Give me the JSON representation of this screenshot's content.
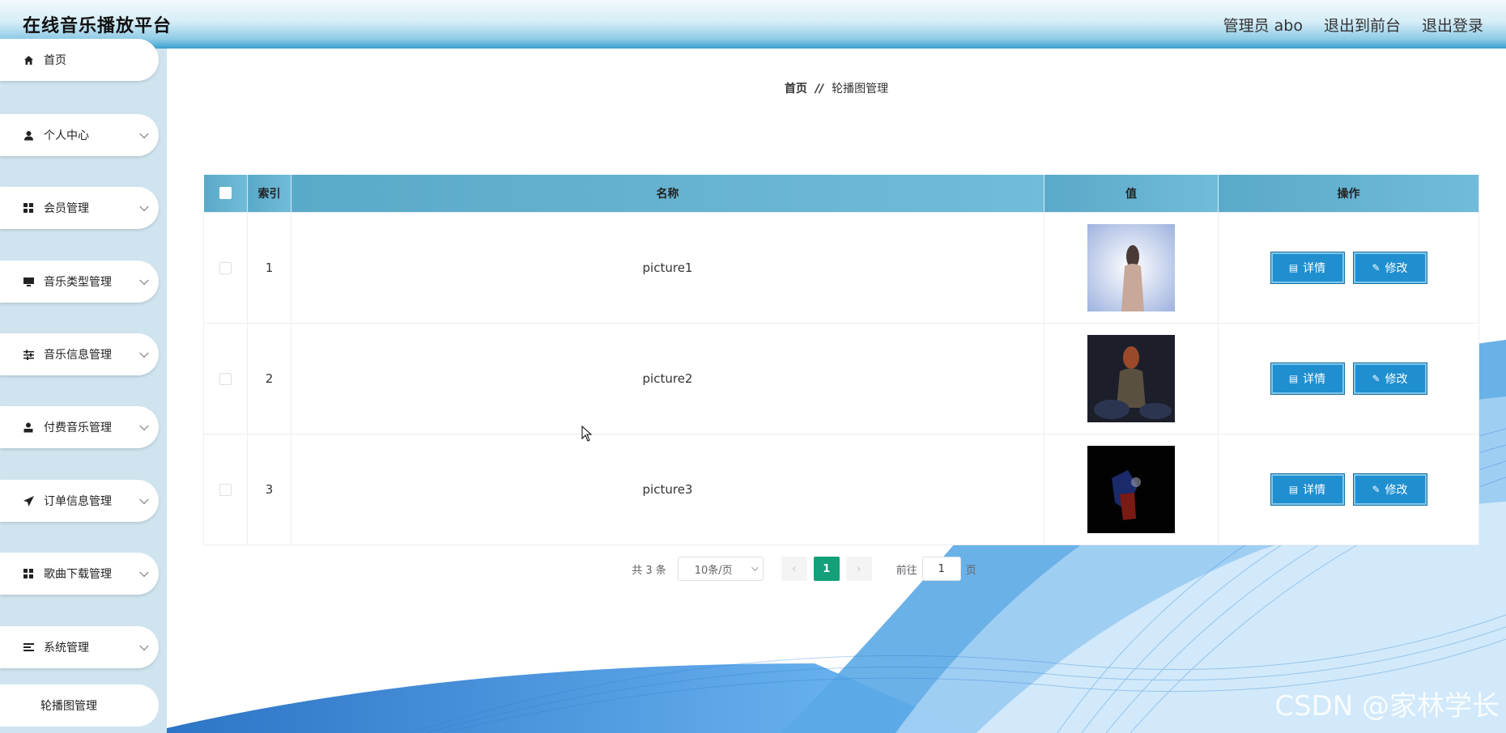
{
  "header": {
    "title": "在线音乐播放平台",
    "admin_label": "管理员 abo",
    "back_front": "退出到前台",
    "logout": "退出登录"
  },
  "sidebar": {
    "items": [
      {
        "label": "首页",
        "icon": "home-icon"
      },
      {
        "label": "个人中心",
        "icon": "user-icon"
      },
      {
        "label": "会员管理",
        "icon": "grid-icon"
      },
      {
        "label": "音乐类型管理",
        "icon": "monitor-icon"
      },
      {
        "label": "音乐信息管理",
        "icon": "sliders-icon"
      },
      {
        "label": "付费音乐管理",
        "icon": "user-solid-icon"
      },
      {
        "label": "订单信息管理",
        "icon": "send-icon"
      },
      {
        "label": "歌曲下载管理",
        "icon": "grid-icon"
      },
      {
        "label": "系统管理",
        "icon": "menu-icon"
      }
    ],
    "sub_item": "轮播图管理"
  },
  "breadcrumb": {
    "home": "首页",
    "separator": "//",
    "current": "轮播图管理"
  },
  "table": {
    "headers": {
      "index": "索引",
      "name": "名称",
      "value": "值",
      "action": "操作"
    },
    "rows": [
      {
        "index": "1",
        "name": "picture1"
      },
      {
        "index": "2",
        "name": "picture2"
      },
      {
        "index": "3",
        "name": "picture3"
      }
    ],
    "detail_label": "详情",
    "edit_label": "修改"
  },
  "pagination": {
    "total": "共 3 条",
    "page_size": "10条/页",
    "current_page": "1",
    "goto_prefix": "前往",
    "goto_value": "1",
    "goto_suffix": "页"
  },
  "watermark": "CSDN @家林学长",
  "colors": {
    "header_accent": "#3b9fd0",
    "table_header": "#5aa9c8",
    "button": "#1f8fd0",
    "active_page": "#13a07a"
  }
}
